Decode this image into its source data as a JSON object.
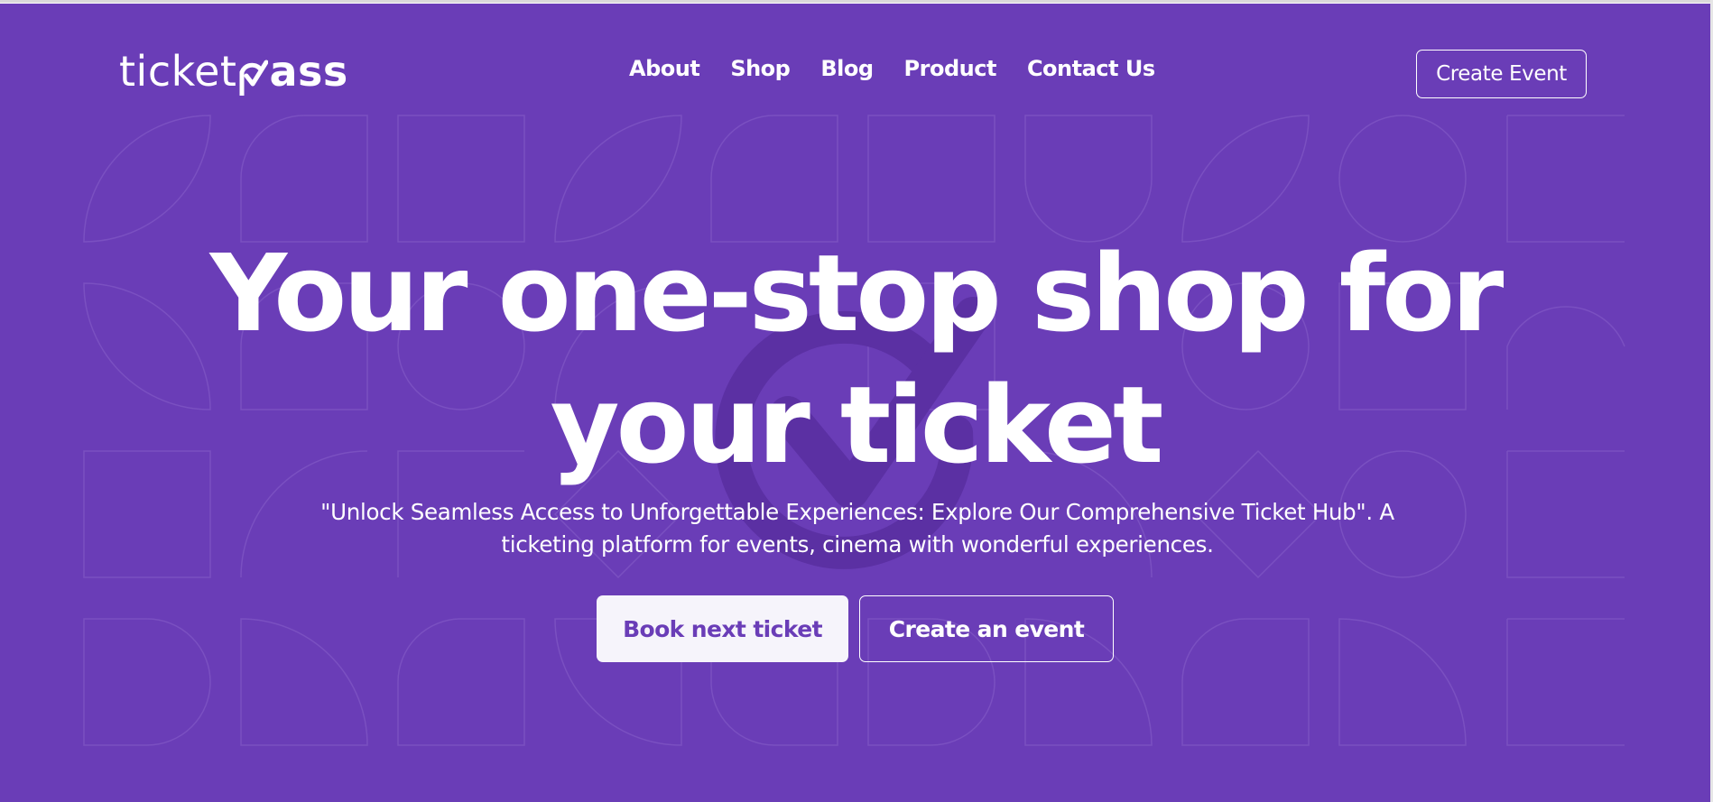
{
  "brand": {
    "logo_left": "ticket",
    "logo_right": "ass"
  },
  "nav": {
    "items": [
      {
        "label": "About"
      },
      {
        "label": "Shop"
      },
      {
        "label": "Blog"
      },
      {
        "label": "Product"
      },
      {
        "label": "Contact Us"
      }
    ]
  },
  "header": {
    "create_event_label": "Create Event"
  },
  "hero": {
    "title_line1": "Your one-stop shop for",
    "title_line2": "your ticket",
    "subtitle": "\"Unlock Seamless Access to Unforgettable Experiences: Explore Our Comprehensive Ticket Hub\". A ticketing platform for events, cinema with wonderful experiences.",
    "primary_button": "Book next ticket",
    "secondary_button": "Create an event"
  },
  "theme": {
    "background": "#6a3db7",
    "pattern_stroke": "#7c52c2",
    "watermark": "#5a2f9e",
    "text": "#ffffff"
  },
  "icons": {
    "logo_check": "check-mark-icon",
    "watermark": "check-circle-icon"
  }
}
